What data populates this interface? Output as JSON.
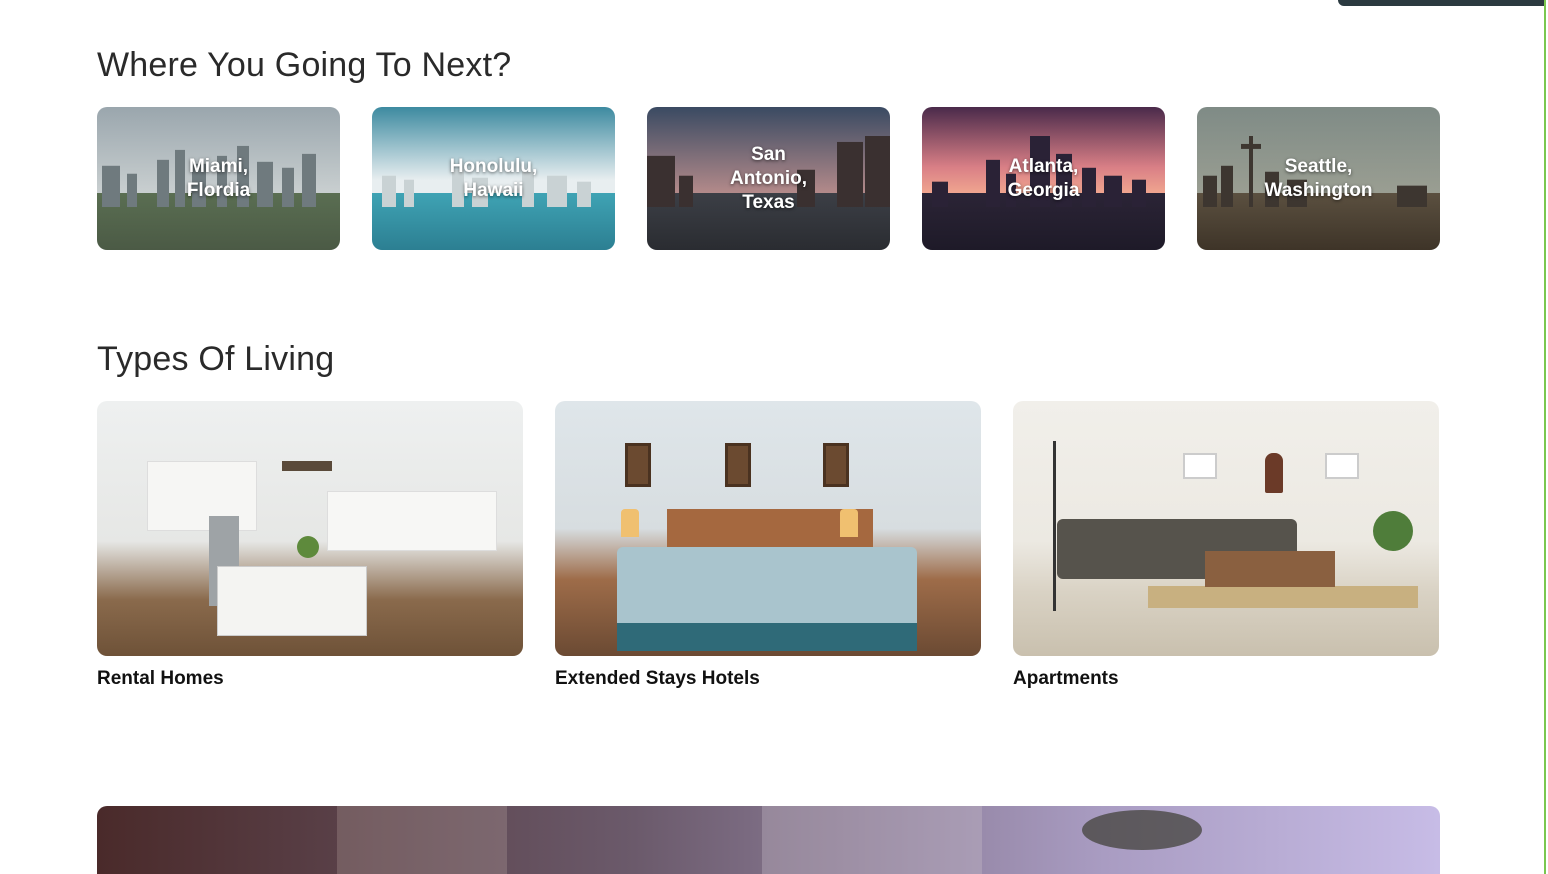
{
  "sections": {
    "destinations_title": "Where You Going To Next?",
    "living_title": "Types Of Living"
  },
  "destinations": [
    {
      "label": "Miami, Flordia"
    },
    {
      "label": "Honolulu, Hawaii"
    },
    {
      "label": "San Antonio, Texas"
    },
    {
      "label": "Atlanta, Georgia"
    },
    {
      "label": "Seattle, Washington"
    }
  ],
  "living_types": [
    {
      "label": "Rental Homes"
    },
    {
      "label": "Extended Stays Hotels"
    },
    {
      "label": "Apartments"
    }
  ],
  "colors": {
    "accent_edge": "#7ac74f",
    "top_bar": "#2b3a40"
  }
}
